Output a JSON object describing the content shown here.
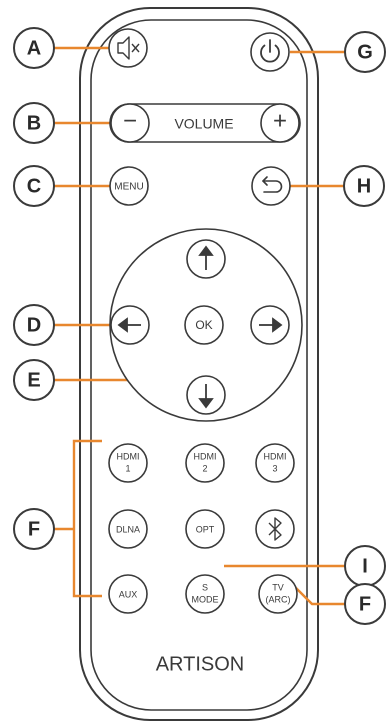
{
  "colors": {
    "accent": "#e8872e",
    "outline": "#3a3a3a"
  },
  "brand": "ARTISON",
  "buttons": {
    "mute": {
      "icon": "mute-icon"
    },
    "power": {
      "icon": "power-icon"
    },
    "volume": {
      "label": "VOLUME",
      "minus": "−",
      "plus": "+"
    },
    "menu": {
      "label": "MENU"
    },
    "back": {
      "icon": "back-icon"
    },
    "nav": {
      "ok": "OK",
      "up": "arrow-up-icon",
      "down": "arrow-down-icon",
      "left": "arrow-left-icon",
      "right": "arrow-right-icon"
    },
    "hdmi1": {
      "line1": "HDMI",
      "line2": "1"
    },
    "hdmi2": {
      "line1": "HDMI",
      "line2": "2"
    },
    "hdmi3": {
      "line1": "HDMI",
      "line2": "3"
    },
    "dlna": {
      "label": "DLNA"
    },
    "opt": {
      "label": "OPT"
    },
    "bluetooth": {
      "icon": "bluetooth-icon"
    },
    "aux": {
      "label": "AUX"
    },
    "smode": {
      "line1": "S",
      "line2": "MODE"
    },
    "tvarc": {
      "line1": "TV",
      "line2": "(ARC)"
    }
  },
  "callouts": {
    "A": "A",
    "B": "B",
    "C": "C",
    "D": "D",
    "E": "E",
    "F1": "F",
    "G": "G",
    "H": "H",
    "I": "I",
    "F2": "F"
  }
}
